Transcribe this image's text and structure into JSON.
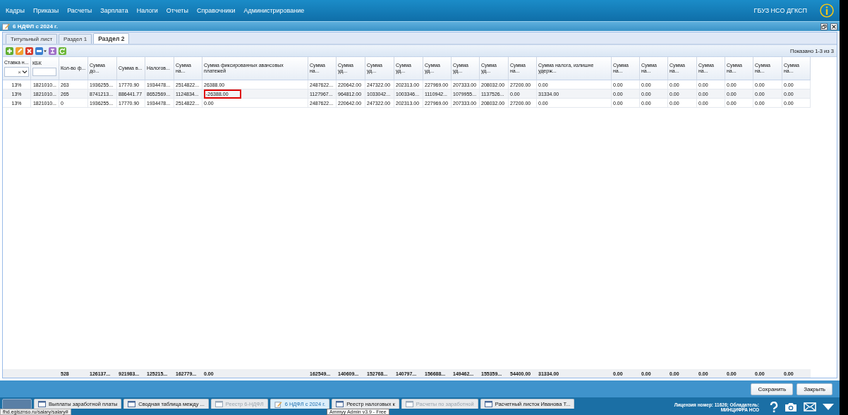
{
  "menu": {
    "items": [
      "Кадры",
      "Приказы",
      "Расчеты",
      "Зарплата",
      "Налоги",
      "Отчеты",
      "Справочники",
      "Администрирование"
    ],
    "organization": "ГБУЗ НСО ДГКСП"
  },
  "window": {
    "title": "6 НДФЛ с 2024 г."
  },
  "tabs": [
    {
      "label": "Титульный лист",
      "selected": false
    },
    {
      "label": "Раздел 1",
      "selected": false
    },
    {
      "label": "Раздел 2",
      "selected": true
    }
  ],
  "toolbar": [
    {
      "kind": "add"
    },
    {
      "kind": "edit"
    },
    {
      "kind": "delete"
    },
    {
      "kind": "print"
    },
    {
      "kind": "export"
    },
    {
      "kind": "refresh"
    }
  ],
  "paging": "Показано 1-3 из 3",
  "grid": {
    "columns": [
      {
        "label": "Ставка н...",
        "select_filter": {
          "clear": "×"
        }
      },
      {
        "label": "КБК",
        "text_filter": true
      },
      {
        "label": "Кол-во ф..."
      },
      {
        "label": "Сумма до..."
      },
      {
        "label": "Сумма в..."
      },
      {
        "label": "Налогов..."
      },
      {
        "label": "Сумма на..."
      },
      {
        "label": "Сумма фиксированных авансовых платежей"
      },
      {
        "label": "Сумма на..."
      },
      {
        "label": "Сумма уд..."
      },
      {
        "label": "Сумма уд..."
      },
      {
        "label": "Сумма уд..."
      },
      {
        "label": "Сумма уд..."
      },
      {
        "label": "Сумма уд..."
      },
      {
        "label": "Сумма уд..."
      },
      {
        "label": "Сумма на..."
      },
      {
        "label": "Сумма налога, излишне удерж..."
      },
      {
        "label": "Сумма на..."
      },
      {
        "label": "Сумма на..."
      },
      {
        "label": "Сумма на..."
      },
      {
        "label": "Сумма на..."
      },
      {
        "label": "Сумма на..."
      },
      {
        "label": "Сумма на..."
      },
      {
        "label": "Сумма на..."
      }
    ],
    "rows": [
      [
        "13%",
        "1821010...",
        "263",
        "1936255...",
        "17770.90",
        "1934478...",
        "2514822...",
        "26388.00",
        "2487622...",
        "220642.00",
        "247322.00",
        "202313.00",
        "227969.00",
        "207333.00",
        "208032.00",
        "27200.00",
        "0.00",
        "0.00",
        "0.00",
        "0.00",
        "0.00",
        "0.00",
        "0.00",
        "0.00"
      ],
      [
        "13%",
        "1821010...",
        "265",
        "8741213...",
        "886441.77",
        "8652569...",
        "1124834...",
        {
          "text": "-26388.00",
          "highlighted": true
        },
        "1127967...",
        "964812.00",
        "1033042...",
        "1003346...",
        "1110942...",
        "1079955...",
        "1137526...",
        "0.00",
        "31334.00",
        "0.00",
        "0.00",
        "0.00",
        "0.00",
        "0.00",
        "0.00",
        "0.00"
      ],
      [
        "13%",
        "1821010...",
        "0",
        "1936255...",
        "17770.90",
        "1934478...",
        "2514822...",
        "0.00",
        "2487622...",
        "220642.00",
        "247322.00",
        "202313.00",
        "227969.00",
        "207333.00",
        "208032.00",
        "27200.00",
        "0.00",
        "0.00",
        "0.00",
        "0.00",
        "0.00",
        "0.00",
        "0.00",
        "0.00"
      ]
    ],
    "totals": [
      "528",
      "126137...",
      "921983...",
      "125215...",
      "162779...",
      "0.00",
      "162549...",
      "140609...",
      "152768...",
      "140797...",
      "156688...",
      "149462...",
      "155359...",
      "54400.00",
      "31334.00",
      "0.00",
      "0.00",
      "0.00",
      "0.00",
      "0.00",
      "0.00",
      "0.00"
    ]
  },
  "buttons": [
    "Сохранить",
    "Закрыть"
  ],
  "taskbar": {
    "items": [
      {
        "label": "Выплаты заработной платы",
        "selected": false,
        "disabled": false
      },
      {
        "label": "Сводная таблица между ...",
        "selected": false,
        "disabled": false
      },
      {
        "label": "Реестр 6-НДФЛ",
        "selected": false,
        "disabled": true
      },
      {
        "label": "6 НДФЛ с 2024 г.",
        "selected": true,
        "disabled": false
      },
      {
        "label": "Реестр налоговых к",
        "selected": false,
        "disabled": false
      },
      {
        "label": "Расчеты по заработной",
        "selected": false,
        "disabled": true
      },
      {
        "label": "Расчетный листок Иванова Т...",
        "selected": false,
        "disabled": false
      }
    ],
    "license": "Лицензия номер: 11626; Обладатель:",
    "owner": "МИНЦИФРА НСО"
  },
  "status_url": "fhd.egisznso.ru/salary/salary#",
  "tooltip": "Ammyy Admin v3.9 - Free"
}
